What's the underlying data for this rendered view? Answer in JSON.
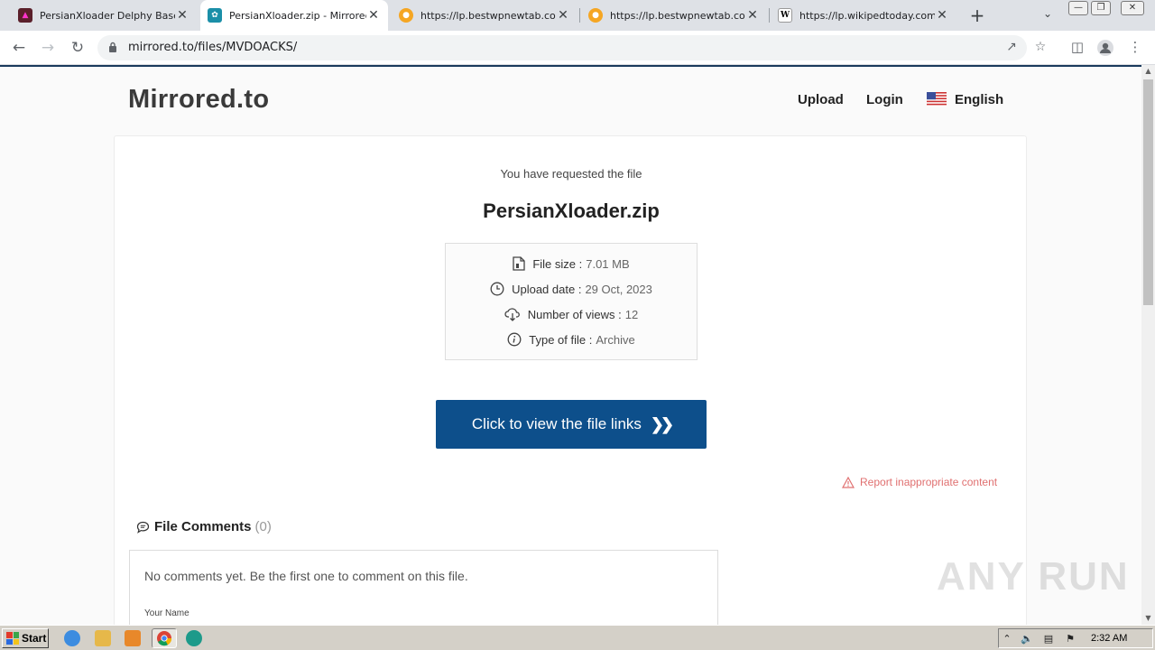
{
  "browser": {
    "tabs": [
      {
        "title": "PersianXloader Delphy Based L",
        "favicon": "trojan-favicon",
        "active": false
      },
      {
        "title": "PersianXloader.zip - Mirrored.t",
        "favicon": "mirrored-favicon",
        "active": true
      },
      {
        "title": "https://lp.bestwpnewtab.com/",
        "favicon": "orange-circle-favicon",
        "active": false
      },
      {
        "title": "https://lp.bestwpnewtab.com/",
        "favicon": "orange-circle-favicon",
        "active": false
      },
      {
        "title": "https://lp.wikipedtoday.com/e",
        "favicon": "wikipedia-favicon",
        "active": false
      }
    ],
    "url": "mirrored.to/files/MVDOACKS/"
  },
  "site": {
    "logo": "Mirrored.to",
    "nav": {
      "upload": "Upload",
      "login": "Login",
      "language": "English"
    }
  },
  "file": {
    "requested_text": "You have requested the file",
    "name": "PersianXloader.zip",
    "info": [
      {
        "label": "File size :",
        "value": "7.01 MB",
        "icon": "file-icon"
      },
      {
        "label": "Upload date :",
        "value": "29 Oct, 2023",
        "icon": "clock-icon"
      },
      {
        "label": "Number of views :",
        "value": "12",
        "icon": "cloud-download-icon"
      },
      {
        "label": "Type of file :",
        "value": "Archive",
        "icon": "info-icon"
      }
    ],
    "view_links_label": "Click to view the file links",
    "report_label": "Report inappropriate content"
  },
  "comments": {
    "title": "File Comments",
    "count": "(0)",
    "empty_text": "No comments yet. Be the first one to comment on this file.",
    "name_label": "Your Name"
  },
  "watermark": "ANY RUN",
  "taskbar": {
    "start_label": "Start",
    "clock": "2:32 AM"
  },
  "colors": {
    "primary_button": "#0d4f8b",
    "report": "#e07070",
    "header_rule": "#1a3a5c"
  }
}
